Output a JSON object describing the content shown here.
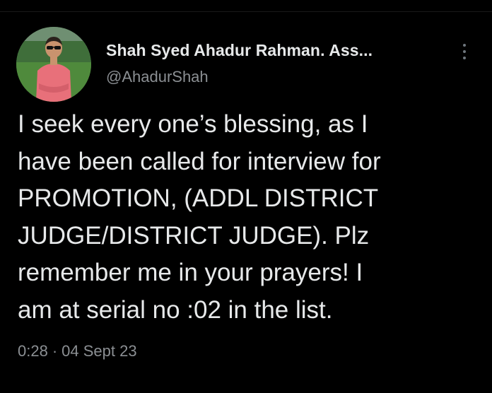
{
  "tweet": {
    "author": {
      "display_name": "Shah Syed Ahadur Rahman. Ass...",
      "handle": "@AhadurShah"
    },
    "text": "I seek every one’s blessing, as I\nhave been called for interview for\nPROMOTION, (ADDL DISTRICT\nJUDGE/DISTRICT JUDGE). Plz\nremember me in your prayers! I\nam at serial no :02 in the list.",
    "time": "0:28",
    "separator": "·",
    "date": "04 Sept 23"
  },
  "icons": {
    "avatar": "profile-photo",
    "more": "more-vertical-icon"
  },
  "colors": {
    "background": "#000000",
    "primary_text": "#e7e9ea",
    "secondary_text": "#8b8f93"
  }
}
